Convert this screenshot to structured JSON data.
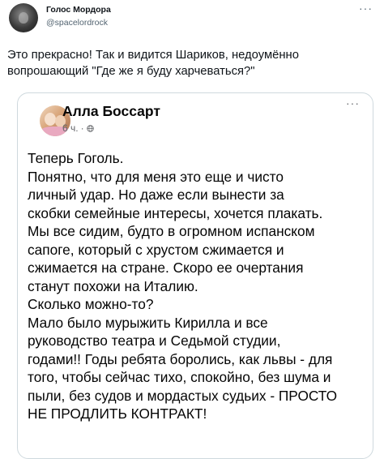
{
  "tweet": {
    "author_name": "Голос Мордора",
    "author_handle": "@spacelordrock",
    "more_glyph": "···",
    "text_lines": [
      "Это прекрасно! Так и видится Шариков, недоумённо",
      "вопрошающий \"Где же я буду харчеваться?\""
    ]
  },
  "quote": {
    "author_name": "Алла Боссарт",
    "time": "6 ч.",
    "separator": "·",
    "more_glyph": "···",
    "icons": {
      "avatar": "user-photo",
      "privacy": "globe-icon"
    },
    "text_lines": [
      "Теперь Гоголь.",
      "Понятно, что для меня это еще и чисто",
      "личный удар. Но даже если вынести за",
      "скобки семейные интересы, хочется плакать.",
      "Мы все сидим, будто в огромном испанском",
      "сапоге, который с хрустом сжимается и",
      "сжимается на стране. Скоро ее очертания",
      "станут похожи на Италию.",
      "Сколько можно-то?",
      "Мало было мурыжить Кирилла и все",
      "руководство театра и Седьмой студии,",
      "годами!! Годы ребята боролись, как львы - для",
      "того, чтобы сейчас тихо, спокойно, без шума и",
      "пыли, без судов и мордастых судьих - ПРОСТО",
      "НЕ ПРОДЛИТЬ КОНТРАКТ!"
    ]
  },
  "colors": {
    "text": "#0f1419",
    "secondary": "#536471",
    "border": "#cfd9de",
    "fb_secondary": "#65676b"
  }
}
